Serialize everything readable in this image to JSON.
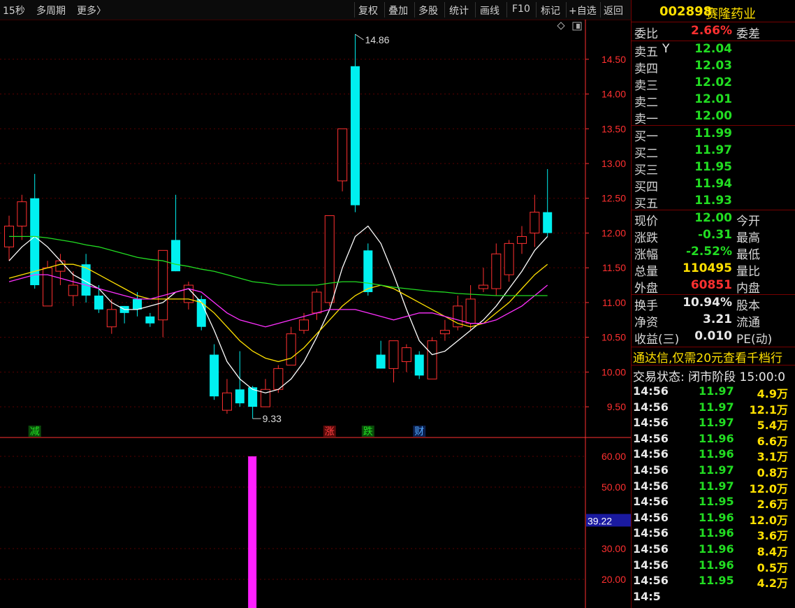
{
  "toolbar": {
    "left": [
      "15秒",
      "多周期",
      "更多〉"
    ],
    "right": [
      "复权",
      "叠加",
      "多股",
      "统计",
      "画线",
      "F10",
      "标记",
      "+自选",
      "返回"
    ]
  },
  "stock": {
    "code": "002898",
    "name": "赛隆药业"
  },
  "ratio": {
    "label": "委比",
    "value": "2.66%",
    "label2": "委差"
  },
  "sells": [
    {
      "label": "卖五",
      "mark": "Y",
      "price": "12.04"
    },
    {
      "label": "卖四",
      "price": "12.03"
    },
    {
      "label": "卖三",
      "price": "12.02"
    },
    {
      "label": "卖二",
      "price": "12.01"
    },
    {
      "label": "卖一",
      "price": "12.00"
    }
  ],
  "buys": [
    {
      "label": "买一",
      "price": "11.99"
    },
    {
      "label": "买二",
      "price": "11.97"
    },
    {
      "label": "买三",
      "price": "11.95"
    },
    {
      "label": "买四",
      "price": "11.94"
    },
    {
      "label": "买五",
      "price": "11.93"
    }
  ],
  "quote": [
    {
      "label": "现价",
      "value": "12.00",
      "color": "green",
      "label2": "今开"
    },
    {
      "label": "涨跌",
      "value": "-0.31",
      "color": "green",
      "label2": "最高"
    },
    {
      "label": "涨幅",
      "value": "-2.52%",
      "color": "green",
      "label2": "最低"
    },
    {
      "label": "总量",
      "value": "110495",
      "color": "yellow",
      "label2": "量比"
    },
    {
      "label": "外盘",
      "value": "60851",
      "color": "red",
      "label2": "内盘"
    }
  ],
  "stats": [
    {
      "label": "换手",
      "value": "10.94%",
      "label2": "股本"
    },
    {
      "label": "净资",
      "value": "3.21",
      "label2": "流通"
    },
    {
      "label": "收益(三)",
      "value": "0.010",
      "label2": "PE(动)"
    }
  ],
  "promo": "通达信,仅需20元查看千档行",
  "trade_status": "交易状态: 闭市阶段 15:00:0",
  "ticks": [
    {
      "time": "14:56",
      "price": "11.97",
      "vol": "4.9万"
    },
    {
      "time": "14:56",
      "price": "11.97",
      "vol": "12.1万"
    },
    {
      "time": "14:56",
      "price": "11.97",
      "vol": "5.4万"
    },
    {
      "time": "14:56",
      "price": "11.96",
      "vol": "6.6万"
    },
    {
      "time": "14:56",
      "price": "11.96",
      "vol": "3.1万"
    },
    {
      "time": "14:56",
      "price": "11.97",
      "vol": "0.8万"
    },
    {
      "time": "14:56",
      "price": "11.97",
      "vol": "12.0万"
    },
    {
      "time": "14:56",
      "price": "11.95",
      "vol": "2.6万"
    },
    {
      "time": "14:56",
      "price": "11.96",
      "vol": "12.0万"
    },
    {
      "time": "14:56",
      "price": "11.96",
      "vol": "3.6万"
    },
    {
      "time": "14:56",
      "price": "11.96",
      "vol": "8.4万"
    },
    {
      "time": "14:56",
      "price": "11.96",
      "vol": "0.5万"
    },
    {
      "time": "14:56",
      "price": "11.95",
      "vol": "4.2万"
    },
    {
      "time": "14:5",
      "price": "",
      "vol": ""
    }
  ],
  "colors": {
    "up": "#ff3030",
    "down": "#00f0f0",
    "ma1": "#ffffff",
    "ma2": "#ffe000",
    "ma3": "#ff30ff",
    "ma4": "#22dd22",
    "grid": "#5a0000",
    "axis": "#ff3030"
  },
  "chart_data": {
    "type": "candlestick",
    "ylim": [
      9.3,
      14.95
    ],
    "yticks": [
      "14.50",
      "14.00",
      "13.50",
      "13.00",
      "12.50",
      "12.00",
      "11.50",
      "11.00",
      "10.50",
      "10.00",
      "9.50"
    ],
    "candles": [
      {
        "o": 11.8,
        "c": 12.1,
        "h": 12.25,
        "l": 11.6
      },
      {
        "o": 12.1,
        "c": 12.45,
        "h": 12.55,
        "l": 11.9
      },
      {
        "o": 12.5,
        "c": 11.25,
        "h": 12.85,
        "l": 11.2
      },
      {
        "o": 10.95,
        "c": 11.5,
        "h": 11.6,
        "l": 10.95
      },
      {
        "o": 11.45,
        "c": 11.6,
        "h": 11.7,
        "l": 11.25
      },
      {
        "o": 11.1,
        "c": 11.25,
        "h": 11.45,
        "l": 10.95
      },
      {
        "o": 11.55,
        "c": 11.1,
        "h": 11.7,
        "l": 11.0
      },
      {
        "o": 11.1,
        "c": 10.9,
        "h": 11.25,
        "l": 10.85
      },
      {
        "o": 10.65,
        "c": 10.9,
        "h": 11.05,
        "l": 10.55
      },
      {
        "o": 10.95,
        "c": 10.85,
        "h": 10.95,
        "l": 10.7
      },
      {
        "o": 11.05,
        "c": 10.9,
        "h": 11.15,
        "l": 10.8
      },
      {
        "o": 10.8,
        "c": 10.7,
        "h": 10.85,
        "l": 10.65
      },
      {
        "o": 10.75,
        "c": 11.75,
        "h": 11.75,
        "l": 10.5
      },
      {
        "o": 11.9,
        "c": 11.45,
        "h": 12.55,
        "l": 11.45
      },
      {
        "o": 11.0,
        "c": 11.25,
        "h": 11.3,
        "l": 10.9
      },
      {
        "o": 11.05,
        "c": 10.65,
        "h": 11.1,
        "l": 10.6
      },
      {
        "o": 10.25,
        "c": 9.65,
        "h": 10.4,
        "l": 9.6
      },
      {
        "o": 9.45,
        "c": 9.7,
        "h": 9.9,
        "l": 9.4
      },
      {
        "o": 9.75,
        "c": 9.55,
        "h": 10.3,
        "l": 9.5
      },
      {
        "o": 9.78,
        "c": 9.5,
        "h": 9.8,
        "l": 9.33
      },
      {
        "o": 9.5,
        "c": 9.75,
        "h": 9.9,
        "l": 9.5
      },
      {
        "o": 9.75,
        "c": 10.05,
        "h": 10.1,
        "l": 9.7
      },
      {
        "o": 10.1,
        "c": 10.55,
        "h": 10.65,
        "l": 10.1
      },
      {
        "o": 10.6,
        "c": 10.75,
        "h": 10.85,
        "l": 10.55
      },
      {
        "o": 10.85,
        "c": 11.15,
        "h": 11.2,
        "l": 10.75
      },
      {
        "o": 11.0,
        "c": 12.25,
        "h": 12.25,
        "l": 10.95
      },
      {
        "o": 12.75,
        "c": 13.5,
        "h": 13.5,
        "l": 12.6
      },
      {
        "o": 14.4,
        "c": 12.4,
        "h": 14.86,
        "l": 12.3
      },
      {
        "o": 11.75,
        "c": 11.15,
        "h": 11.85,
        "l": 11.1
      },
      {
        "o": 10.25,
        "c": 10.05,
        "h": 10.45,
        "l": 10.05
      },
      {
        "o": 10.05,
        "c": 10.45,
        "h": 10.45,
        "l": 9.85
      },
      {
        "o": 10.15,
        "c": 10.35,
        "h": 10.4,
        "l": 10.0
      },
      {
        "o": 10.25,
        "c": 9.95,
        "h": 10.3,
        "l": 9.9
      },
      {
        "o": 9.9,
        "c": 10.45,
        "h": 10.5,
        "l": 9.9
      },
      {
        "o": 10.55,
        "c": 10.6,
        "h": 10.75,
        "l": 10.45
      },
      {
        "o": 10.65,
        "c": 10.95,
        "h": 11.1,
        "l": 10.6
      },
      {
        "o": 10.7,
        "c": 11.05,
        "h": 11.25,
        "l": 10.6
      },
      {
        "o": 11.2,
        "c": 11.25,
        "h": 11.5,
        "l": 11.15
      },
      {
        "o": 11.2,
        "c": 11.7,
        "h": 11.85,
        "l": 11.1
      },
      {
        "o": 11.4,
        "c": 11.85,
        "h": 11.9,
        "l": 11.3
      },
      {
        "o": 11.85,
        "c": 11.95,
        "h": 12.1,
        "l": 11.7
      },
      {
        "o": 12.0,
        "c": 12.3,
        "h": 12.55,
        "l": 11.8
      },
      {
        "o": 12.3,
        "c": 12.0,
        "h": 12.92,
        "l": 11.95
      }
    ],
    "ma": [
      {
        "color": "#ffffff",
        "values": [
          11.6,
          11.8,
          11.95,
          11.8,
          11.6,
          11.4,
          11.3,
          11.2,
          11.0,
          10.9,
          10.9,
          10.95,
          11.0,
          11.15,
          11.2,
          11.0,
          10.6,
          10.15,
          9.9,
          9.75,
          9.7,
          9.75,
          9.9,
          10.15,
          10.5,
          10.9,
          11.5,
          11.95,
          12.1,
          11.85,
          11.4,
          10.9,
          10.45,
          10.25,
          10.3,
          10.45,
          10.6,
          10.75,
          10.95,
          11.2,
          11.45,
          11.75,
          11.95
        ]
      },
      {
        "color": "#ffe000",
        "values": [
          11.35,
          11.4,
          11.45,
          11.5,
          11.55,
          11.55,
          11.5,
          11.4,
          11.3,
          11.2,
          11.1,
          11.05,
          11.05,
          11.05,
          11.05,
          11.0,
          10.85,
          10.65,
          10.45,
          10.3,
          10.2,
          10.15,
          10.2,
          10.35,
          10.55,
          10.75,
          10.95,
          11.1,
          11.2,
          11.25,
          11.2,
          11.1,
          11.0,
          10.9,
          10.8,
          10.7,
          10.65,
          10.7,
          10.85,
          11.0,
          11.2,
          11.4,
          11.55
        ]
      },
      {
        "color": "#ff30ff",
        "values": [
          11.3,
          11.35,
          11.4,
          11.4,
          11.35,
          11.3,
          11.25,
          11.2,
          11.15,
          11.1,
          11.05,
          11.05,
          11.1,
          11.15,
          11.2,
          11.15,
          11.0,
          10.85,
          10.75,
          10.7,
          10.65,
          10.7,
          10.75,
          10.8,
          10.85,
          10.9,
          10.9,
          10.9,
          10.85,
          10.8,
          10.75,
          10.8,
          10.85,
          10.85,
          10.8,
          10.75,
          10.7,
          10.7,
          10.75,
          10.85,
          10.95,
          11.1,
          11.25
        ]
      },
      {
        "color": "#22dd22",
        "values": [
          11.95,
          11.95,
          11.95,
          11.93,
          11.9,
          11.87,
          11.83,
          11.8,
          11.75,
          11.7,
          11.65,
          11.62,
          11.6,
          11.55,
          11.52,
          11.48,
          11.45,
          11.4,
          11.35,
          11.3,
          11.28,
          11.25,
          11.25,
          11.25,
          11.25,
          11.28,
          11.3,
          11.3,
          11.28,
          11.25,
          11.22,
          11.2,
          11.18,
          11.16,
          11.15,
          11.13,
          11.12,
          11.11,
          11.1,
          11.1,
          11.1,
          11.1,
          11.1
        ]
      }
    ],
    "high_label": "14.86",
    "low_label": "9.33",
    "markers": [
      "减",
      "涨",
      "跌",
      "财"
    ],
    "indicator": {
      "ylim": [
        10,
        60
      ],
      "yticks": [
        "60.00",
        "50.00",
        "30.00",
        "20.00"
      ],
      "current": "39.22",
      "bars": [
        {
          "index": 19,
          "value": 60
        }
      ]
    }
  }
}
